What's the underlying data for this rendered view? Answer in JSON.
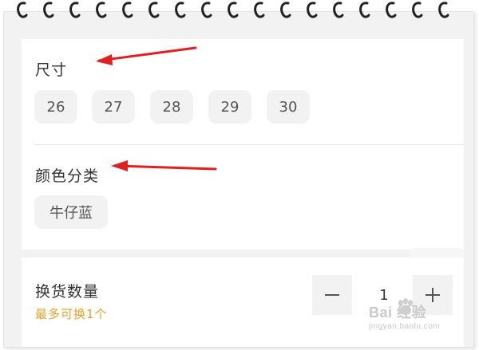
{
  "size_section": {
    "title": "尺寸",
    "options": [
      "26",
      "27",
      "28",
      "29",
      "30"
    ]
  },
  "color_section": {
    "title": "颜色分类",
    "options": [
      "牛仔蓝"
    ]
  },
  "quantity_section": {
    "title": "换货数量",
    "hint": "最多可换1个",
    "value": "1",
    "decrement_symbol": "−",
    "increment_symbol": "+"
  },
  "watermark": {
    "logo_text": "Bai 经验",
    "url": "jingyan.baidu.com"
  },
  "colors": {
    "accent_hint": "#e0a22c",
    "annotation_arrow": "#e02020",
    "chip_bg": "#f2f2f2"
  },
  "icons": [
    "notebook-ring-icon",
    "annotation-arrow-icon",
    "minus-icon",
    "plus-icon",
    "baidu-paw-icon"
  ]
}
